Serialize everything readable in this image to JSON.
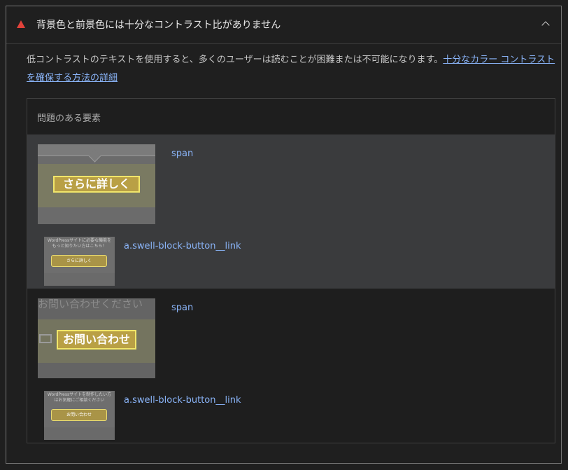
{
  "header": {
    "title": "背景色と前景色には十分なコントラスト比がありません",
    "warning_icon": "warning-triangle-icon",
    "collapse_icon": "chevron-up-icon"
  },
  "description": {
    "text": "低コントラストのテキストを使用すると、多くのユーザーは読むことが困難または不可能になります。",
    "link": "十分なカラー コントラストを確保する方法の詳細"
  },
  "table": {
    "header": "問題のある要素",
    "rows": [
      {
        "primary_label": "span",
        "secondary_label": "a.swell-block-button__link",
        "thumb_button_text": "さらに詳しく",
        "small_thumb_text": "さらに詳しく",
        "small_thumb_caption": "WordPressサイトに必要な機能をもっと知りたい方はこちら！"
      },
      {
        "primary_label": "span",
        "secondary_label": "a.swell-block-button__link",
        "thumb_heading": "お問い合わせください",
        "thumb_button_text": "お問い合わせ",
        "small_thumb_text": "お問い合わせ",
        "small_thumb_caption": "WordPressサイトを制作したい方はお気軽にご相談ください"
      }
    ]
  },
  "colors": {
    "accent_link": "#8ab4f8",
    "warning": "#e0423a",
    "background": "#1f1f1f"
  }
}
